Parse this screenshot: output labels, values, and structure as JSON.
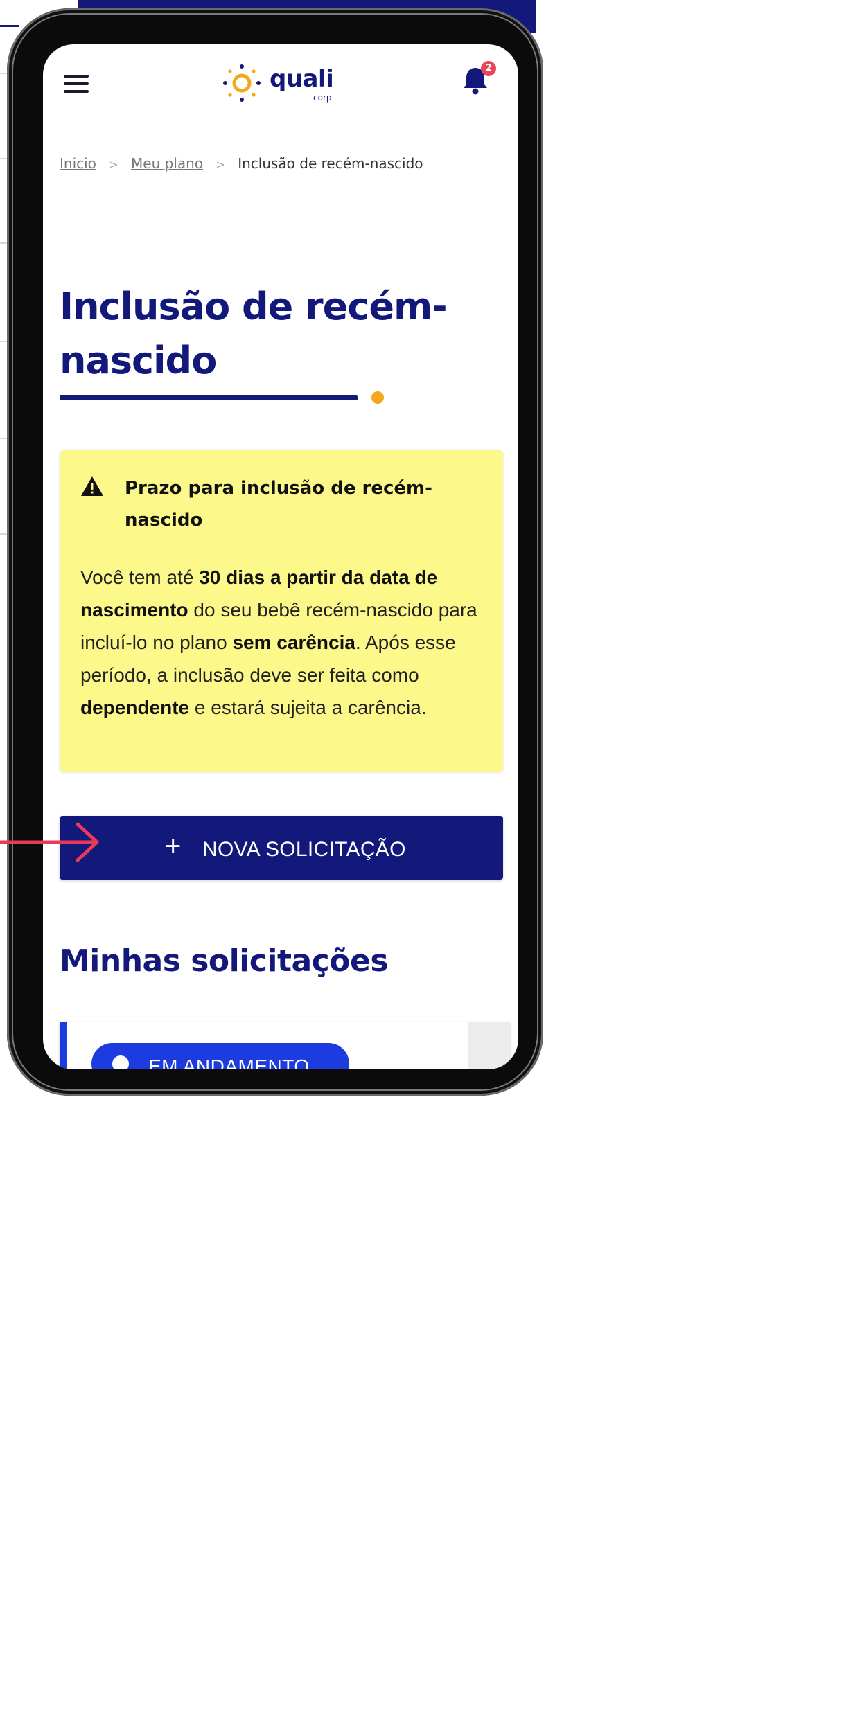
{
  "app": {
    "logo_name": "quali",
    "logo_sub": "corp",
    "notification_count": "2"
  },
  "breadcrumb": {
    "items": [
      "Inicio",
      "Meu plano"
    ],
    "current": "Inclusão de recém-nascido"
  },
  "page": {
    "title": "Inclusão de recém-nascido"
  },
  "alert": {
    "title": "Prazo para inclusão de recém-nascido",
    "body_1": "Você tem até ",
    "body_2": "30 dias a partir da data de nascimento",
    "body_3": " do seu bebê recém-nascido para incluí-lo no plano ",
    "body_4": "sem carência",
    "body_5": ". Após esse período, a inclusão deve ser feita como ",
    "body_6": "dependente",
    "body_7": " e estará sujeita a carência."
  },
  "cta": {
    "icon": "+",
    "label": "NOVA SOLICITAÇÃO"
  },
  "requests": {
    "section_title": "Minhas solicitações",
    "items": [
      {
        "status": "EM ANDAMENTO"
      }
    ]
  },
  "colors": {
    "brand_navy": "#12197a",
    "accent_orange": "#f4a81d",
    "alert_yellow": "#fdf88a",
    "status_blue": "#1d3ce0",
    "badge_red": "#e8465c",
    "annotation_pink": "#ea3a5c"
  }
}
